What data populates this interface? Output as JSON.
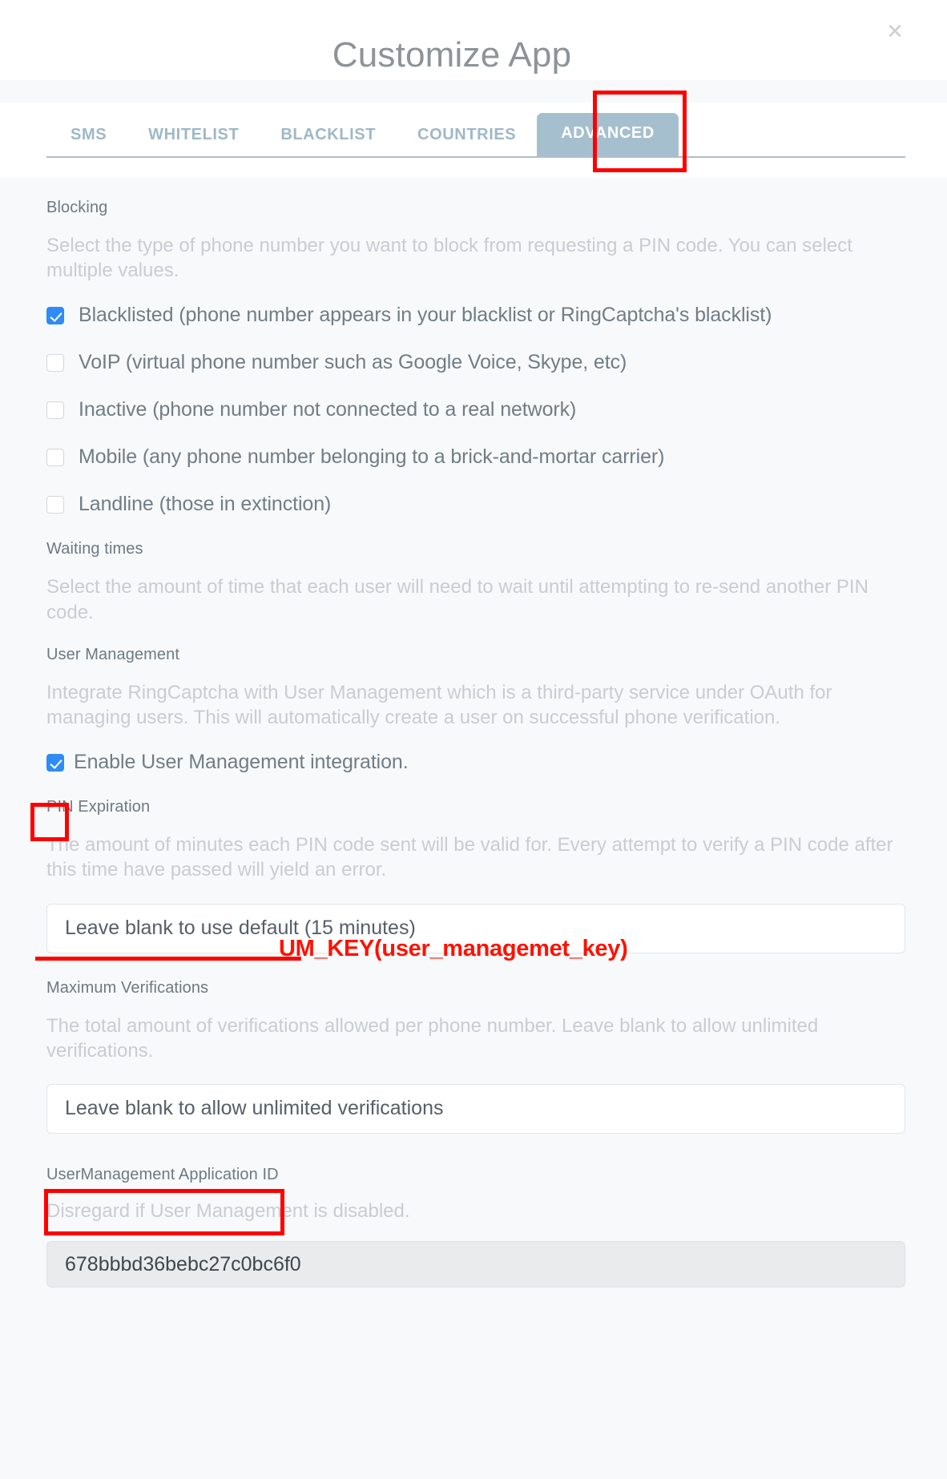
{
  "modal": {
    "title": "Customize App",
    "close_icon": "close-icon",
    "close_glyph": "×"
  },
  "tabs": [
    {
      "label": "SMS",
      "active": false
    },
    {
      "label": "WHITELIST",
      "active": false
    },
    {
      "label": "BLACKLIST",
      "active": false
    },
    {
      "label": "COUNTRIES",
      "active": false
    },
    {
      "label": "ADVANCED",
      "active": true
    }
  ],
  "sections": {
    "blocking": {
      "label": "Blocking",
      "description": "Select the type of phone number you want to block from requesting a PIN code. You can select multiple values.",
      "options": [
        {
          "label": "Blacklisted (phone number appears in your blacklist or RingCaptcha's blacklist)",
          "checked": true
        },
        {
          "label": "VoIP (virtual phone number such as Google Voice, Skype, etc)",
          "checked": false
        },
        {
          "label": "Inactive (phone number not connected to a real network)",
          "checked": false
        },
        {
          "label": "Mobile (any phone number belonging to a brick-and-mortar carrier)",
          "checked": false
        },
        {
          "label": "Landline (those in extinction)",
          "checked": false
        }
      ]
    },
    "waiting_times": {
      "label": "Waiting times",
      "description": "Select the amount of time that each user will need to wait until attempting to re-send another PIN code."
    },
    "user_management": {
      "label": "User Management",
      "description": "Integrate RingCaptcha with User Management which is a third-party service under OAuth for managing users. This will automatically create a user on successful phone verification.",
      "enable_label": "Enable User Management integration.",
      "enabled": true
    },
    "pin_expiration": {
      "label": "PIN Expiration",
      "description": "The amount of minutes each PIN code sent will be valid for. Every attempt to verify a PIN code after this time have passed will yield an error.",
      "input_placeholder": "Leave blank to use default (15 minutes)",
      "input_value": ""
    },
    "maximum_verifications": {
      "label": "Maximum Verifications",
      "description": "The total amount of verifications allowed per phone number. Leave blank to allow unlimited verifications.",
      "input_placeholder": "Leave blank to allow unlimited verifications",
      "input_value": ""
    },
    "um_application_id": {
      "label": "UserManagement Application ID",
      "description": "Disregard if User Management is disabled.",
      "input_value": "678bbbd36bebc27c0bc6f0"
    }
  },
  "annotations": {
    "um_key_text": "UM_KEY(user_managemet_key)",
    "highlight_color": "#ff0000"
  }
}
